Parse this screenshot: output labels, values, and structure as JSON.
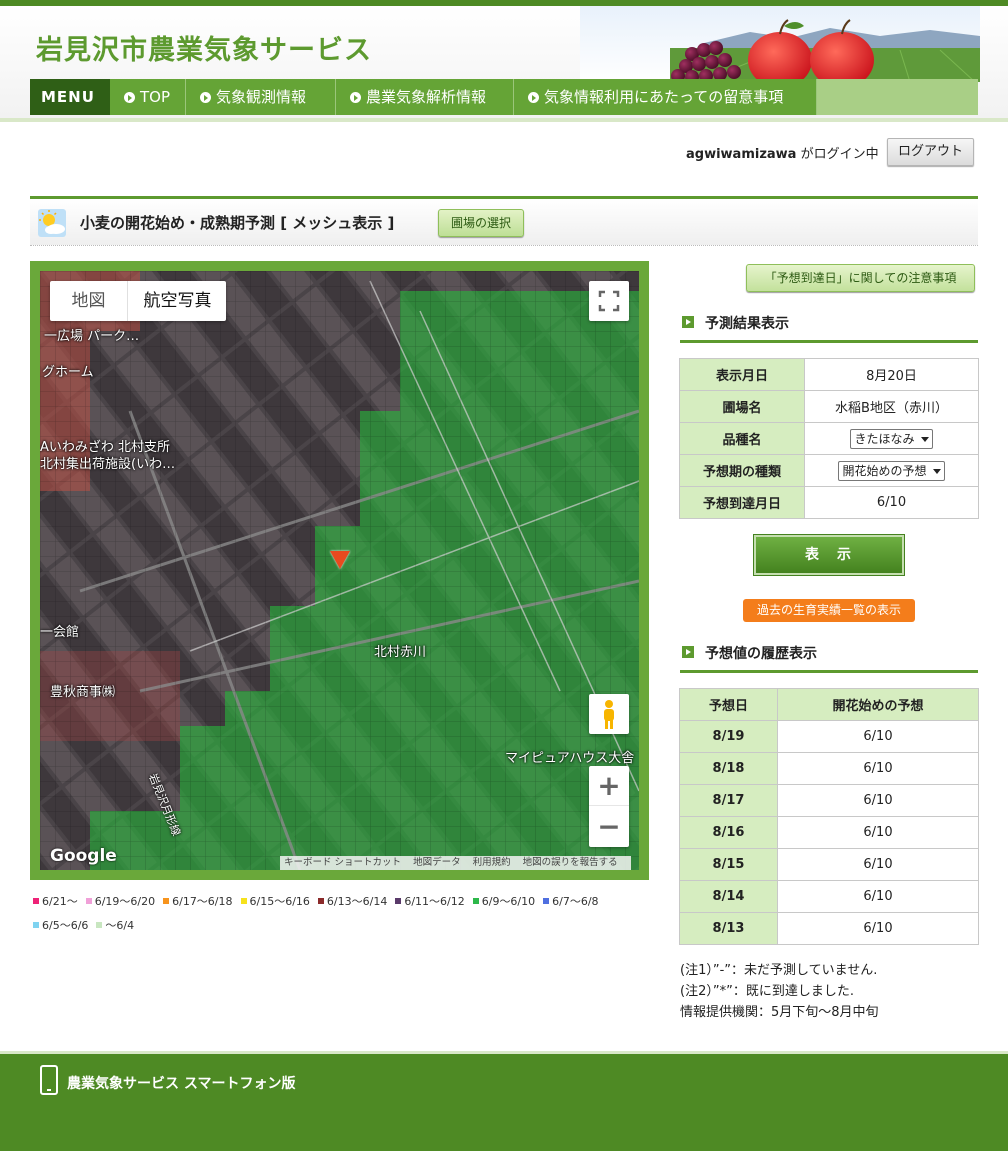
{
  "site": {
    "title": "岩見沢市農業気象サービス"
  },
  "nav": {
    "menu_label": "MENU",
    "items": [
      {
        "label": "TOP"
      },
      {
        "label": "気象観測情報"
      },
      {
        "label": "農業気象解析情報"
      },
      {
        "label": "気象情報利用にあたっての留意事項"
      }
    ]
  },
  "login": {
    "user": "agwiwamizawa",
    "status_text": "がログイン中",
    "logout_label": "ログアウト"
  },
  "section": {
    "title": "小麦の開花始め・成熟期予測 [ メッシュ表示 ]",
    "field_select_label": "圃場の選択"
  },
  "map": {
    "type_map": "地図",
    "type_aerial": "航空写真",
    "google": "Google",
    "attribution": [
      "キーボード ショートカット",
      "地図データ",
      "利用規約",
      "地図の誤りを報告する"
    ],
    "labels": [
      "一広場 パーク…",
      "グホーム",
      "Aいわみざわ 北村支所",
      "北村集出荷施設(いわ…",
      "一会館",
      "豊秋商事㈱",
      "北村赤川",
      "マイピュアハウス大舎",
      "岩見沢月形線"
    ]
  },
  "legend": [
    {
      "label": "6/21～",
      "color": "#ee2277"
    },
    {
      "label": "6/19～6/20",
      "color": "#f0a0d8"
    },
    {
      "label": "6/17～6/18",
      "color": "#f7941d"
    },
    {
      "label": "6/15～6/16",
      "color": "#f6e21c"
    },
    {
      "label": "6/13～6/14",
      "color": "#8b2a2a"
    },
    {
      "label": "6/11～6/12",
      "color": "#5a3a6a"
    },
    {
      "label": "6/9～6/10",
      "color": "#2db84a"
    },
    {
      "label": "6/7～6/8",
      "color": "#4f6fe0"
    },
    {
      "label": "6/5～6/6",
      "color": "#7fd3f0"
    },
    {
      "label": "～6/4",
      "color": "#c8e6c0"
    }
  ],
  "notice_label": "「予想到達日」に関しての注意事項",
  "result": {
    "heading": "予測結果表示",
    "rows": [
      {
        "label": "表示月日",
        "value": "8月20日"
      },
      {
        "label": "圃場名",
        "value": "水稲B地区（赤川）"
      },
      {
        "label": "品種名",
        "value": "きたほなみ"
      },
      {
        "label": "予想期の種類",
        "value": "開花始めの予想"
      },
      {
        "label": "予想到達月日",
        "value": "6/10"
      }
    ],
    "show_label": "表　示",
    "past_label": "過去の生育実績一覧の表示"
  },
  "history": {
    "heading": "予想値の履歴表示",
    "col_date": "予想日",
    "col_value": "開花始めの予想",
    "rows": [
      {
        "date": "8/19",
        "value": "6/10"
      },
      {
        "date": "8/18",
        "value": "6/10"
      },
      {
        "date": "8/17",
        "value": "6/10"
      },
      {
        "date": "8/16",
        "value": "6/10"
      },
      {
        "date": "8/15",
        "value": "6/10"
      },
      {
        "date": "8/14",
        "value": "6/10"
      },
      {
        "date": "8/13",
        "value": "6/10"
      }
    ]
  },
  "notes": [
    "(注1）”-”：未だ予測していません.",
    "(注2）”*”：既に到達しました.",
    "情報提供機関：5月下旬～8月中旬"
  ],
  "footer": {
    "smartphone_label": "農業気象サービス スマートフォン版"
  },
  "colors": {
    "brand_green": "#5d9a2f",
    "nav_green": "#65a436",
    "dark_green": "#2f5f16",
    "accent_orange": "#f47d1b"
  }
}
